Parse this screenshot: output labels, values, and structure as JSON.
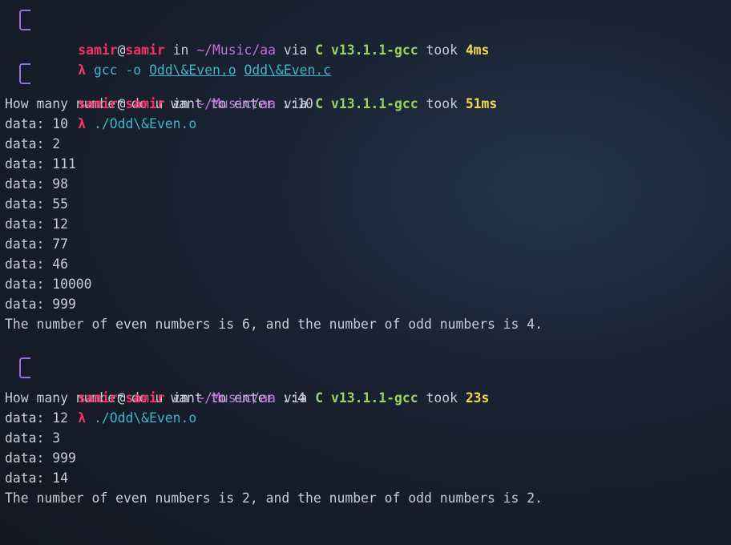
{
  "sessions": [
    {
      "prompt": {
        "user": "samir",
        "at": "@",
        "host": "samir",
        "in_word": " in ",
        "dir": "~/Music/aa",
        "via_word": " via ",
        "lang": "C v13.1.1-gcc",
        "took_word": " took ",
        "took": "4ms"
      },
      "command": {
        "lambda": "λ",
        "cmd": "gcc -o",
        "args": [
          "Odd\\&Even.o",
          "Odd\\&Even.c"
        ]
      },
      "output": []
    },
    {
      "prompt": {
        "user": "samir",
        "at": "@",
        "host": "samir",
        "in_word": " in ",
        "dir": "~/Music/aa",
        "via_word": " via ",
        "lang": "C v13.1.1-gcc",
        "took_word": " took ",
        "took": "51ms"
      },
      "command": {
        "lambda": "λ",
        "cmd": "./Odd\\&Even.o",
        "args": []
      },
      "output": [
        "How many number do u want to enter ::10",
        "data: 10",
        "data: 2",
        "data: 111",
        "data: 98",
        "data: 55",
        "data: 12",
        "data: 77",
        "data: 46",
        "data: 10000",
        "data: 999",
        "The number of even numbers is 6, and the number of odd numbers is 4."
      ]
    },
    {
      "prompt": {
        "user": "samir",
        "at": "@",
        "host": "samir",
        "in_word": " in ",
        "dir": "~/Music/aa",
        "via_word": " via ",
        "lang": "C v13.1.1-gcc",
        "took_word": " took ",
        "took": "23s"
      },
      "command": {
        "lambda": "λ",
        "cmd": "./Odd\\&Even.o",
        "args": []
      },
      "output": [
        "How many number do u want to enter ::4",
        "data: 12",
        "data: 3",
        "data: 999",
        "data: 14",
        "The number of even numbers is 2, and the number of odd numbers is 2."
      ]
    }
  ],
  "colors": {
    "user": "#f0336a",
    "path": "#c66fe0",
    "lang": "#9ad45a",
    "took": "#f6d64d",
    "command": "#3fb6c8",
    "output": "#c8ccd8"
  }
}
